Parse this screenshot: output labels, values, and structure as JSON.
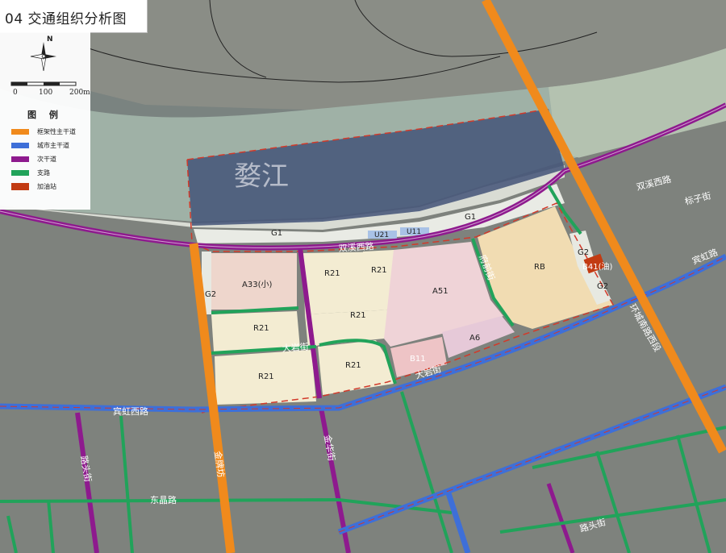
{
  "title": "04  交通组织分析图",
  "river_label": "婺江",
  "compass_letter": "N",
  "scale": {
    "labels": [
      "0",
      "100",
      "200m"
    ]
  },
  "legend": {
    "heading": "图 例",
    "items": [
      {
        "label": "框架性主干道",
        "color": "#f08a1c"
      },
      {
        "label": "城市主干道",
        "color": "#3e6fd8"
      },
      {
        "label": "次干道",
        "color": "#8e1a8e"
      },
      {
        "label": "支路",
        "color": "#21a35a"
      },
      {
        "label": "加油站",
        "color": "#c23b12"
      }
    ]
  },
  "roads": {
    "shuangxi_w": "双溪西路",
    "shuangxi_w2": "双溪西路",
    "binhong_w": "宾虹西路",
    "binhong": "宾虹路",
    "dongsheng": "东晶路",
    "huanchengnan": "环城南路西段",
    "dadian": "大岩街",
    "dadian2": "大岩街",
    "fuqian": "府前街",
    "jinpaifang": "金牌坊",
    "jinhua": "金华街",
    "ludu": "路头街",
    "ludu2": "路头街",
    "biaozi": "标子街"
  },
  "parcels": {
    "A33": "A33(小)",
    "R21_a": "R21",
    "R21_b": "R21",
    "R21_c": "R21",
    "R21_d": "R21",
    "R21_e": "R21",
    "R21_f": "R21",
    "A51": "A51",
    "A6": "A6",
    "B11": "B11",
    "RB": "RB",
    "B41": "B41(油)",
    "G1_a": "G1",
    "G1_b": "G1",
    "G2_a": "G2",
    "G2_b": "G2",
    "G2_c": "G2",
    "U21": "U21",
    "U11": "U11"
  }
}
